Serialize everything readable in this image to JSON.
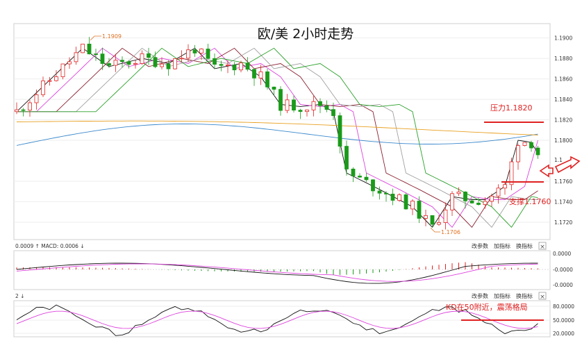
{
  "chart_data": {
    "type": "candlestick",
    "title": "欧/美 2小时走势",
    "main_panel": {
      "ylim": [
        1.1703,
        1.1914
      ],
      "y_ticks": [
        "1.1900",
        "1.1880",
        "1.1860",
        "1.1840",
        "1.1820",
        "1.1800",
        "1.1760",
        "1.1740",
        "1.1720"
      ],
      "y_tick_values": [
        1.19,
        1.188,
        1.186,
        1.184,
        1.182,
        1.18,
        1.176,
        1.174,
        1.172
      ],
      "cut_off_tick": "1.1",
      "high_marker": {
        "label": "1.1909",
        "value": 1.1909
      },
      "low_marker": {
        "label": "1.1706",
        "value": 1.1706
      },
      "candle_count": 72,
      "moving_averages": [
        {
          "color": "#111111",
          "from": 1.1822,
          "to": 1.1791
        },
        {
          "color": "#dd44dd",
          "from": 1.1818,
          "to": 1.1784
        },
        {
          "color": "#8b2030",
          "from": 1.1815,
          "to": 1.1777
        },
        {
          "color": "#a0a0a0",
          "from": 1.1812,
          "to": 1.1772
        },
        {
          "color": "#2aa02a",
          "from": 1.1808,
          "to": 1.1764
        },
        {
          "color": "#3a88cc",
          "from": 1.1795,
          "to": 1.1815
        },
        {
          "color": "#e8a020",
          "from": 1.1818,
          "to": 1.1808
        }
      ],
      "annotations": [
        {
          "text": "压力1.1820",
          "value": 1.1818
        },
        {
          "text": "支撑1.1760",
          "value": 1.1758
        }
      ]
    },
    "macd_panel": {
      "legend": "0.0009  ↑  MACD: 0.0006  ↓",
      "y_ticks": [
        "0.0000",
        "-0.0000",
        "-0.0000"
      ],
      "buttons": [
        "改参数",
        "加指标",
        "换指标"
      ],
      "close_icon": "×"
    },
    "kd_panel": {
      "legend": "2  ↓",
      "y_ticks": [
        "80.0000",
        "50.0000",
        "20.0000"
      ],
      "buttons": [
        "改参数",
        "加指标",
        "换指标"
      ],
      "close_icon": "×",
      "annotation": "KD在50附近，震荡格局"
    },
    "colors": {
      "up": "#e02020",
      "down": "#1a9a1a",
      "annotation": "#e02020",
      "arrow": "#e02020"
    },
    "icons": [
      "up-arrow-icon",
      "down-arrow-icon",
      "close-icon",
      "double-arrow-icon"
    ]
  }
}
